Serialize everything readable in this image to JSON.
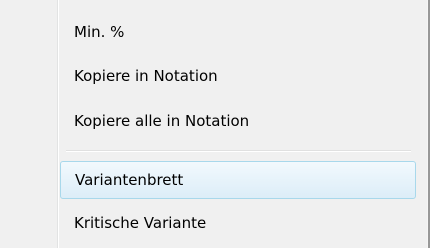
{
  "context_menu": {
    "items": [
      {
        "label": "Min. %"
      },
      {
        "label": "Kopiere in Notation"
      },
      {
        "label": "Kopiere alle in Notation"
      },
      {
        "label": "Variantenbrett",
        "highlighted": true
      },
      {
        "label": "Kritische Variante"
      }
    ]
  },
  "colors": {
    "menu_background": "#f0f0f0",
    "highlight_border": "#a8d8eb",
    "highlight_fill_top": "#f2f9fd",
    "highlight_fill_bottom": "#dcedf8",
    "frame_edge": "#979797"
  }
}
